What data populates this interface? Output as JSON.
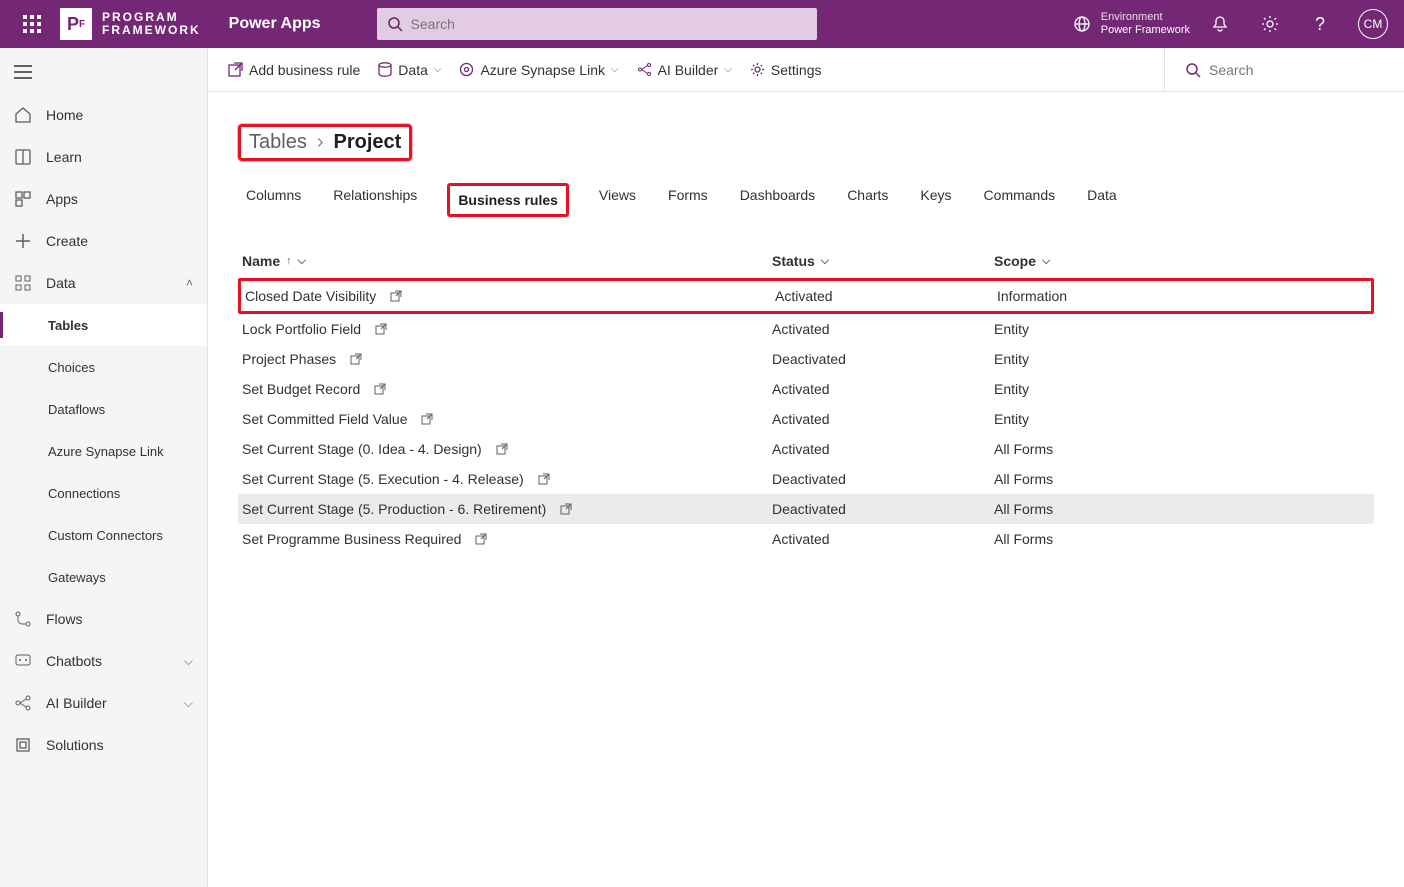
{
  "header": {
    "logo_line1": "PROGRAM",
    "logo_line2": "FRAMEWORK",
    "app_name": "Power Apps",
    "search_placeholder": "Search",
    "env_label": "Environment",
    "env_name": "Power Framework",
    "avatar_initials": "CM"
  },
  "sidebar": {
    "items": [
      {
        "icon": "home",
        "label": "Home"
      },
      {
        "icon": "book",
        "label": "Learn"
      },
      {
        "icon": "grid",
        "label": "Apps"
      },
      {
        "icon": "plus",
        "label": "Create"
      },
      {
        "icon": "data",
        "label": "Data",
        "expanded": true
      },
      {
        "sub": true,
        "label": "Tables",
        "selected": true
      },
      {
        "sub": true,
        "label": "Choices"
      },
      {
        "sub": true,
        "label": "Dataflows"
      },
      {
        "sub": true,
        "label": "Azure Synapse Link"
      },
      {
        "sub": true,
        "label": "Connections"
      },
      {
        "sub": true,
        "label": "Custom Connectors"
      },
      {
        "sub": true,
        "label": "Gateways"
      },
      {
        "icon": "flow",
        "label": "Flows"
      },
      {
        "icon": "chatbot",
        "label": "Chatbots",
        "chevron": true
      },
      {
        "icon": "ai",
        "label": "AI Builder",
        "chevron": true
      },
      {
        "icon": "solutions",
        "label": "Solutions"
      }
    ]
  },
  "toolbar": {
    "add_business_rule": "Add business rule",
    "data": "Data",
    "azure_synapse": "Azure Synapse Link",
    "ai_builder": "AI Builder",
    "settings": "Settings",
    "search_placeholder": "Search"
  },
  "breadcrumb": {
    "parent": "Tables",
    "current": "Project"
  },
  "tabs": [
    "Columns",
    "Relationships",
    "Business rules",
    "Views",
    "Forms",
    "Dashboards",
    "Charts",
    "Keys",
    "Commands",
    "Data"
  ],
  "active_tab": "Business rules",
  "columns": {
    "name": "Name",
    "status": "Status",
    "scope": "Scope"
  },
  "rows": [
    {
      "name": "Closed Date Visibility",
      "status": "Activated",
      "scope": "Information",
      "highlighted": true
    },
    {
      "name": "Lock Portfolio Field",
      "status": "Activated",
      "scope": "Entity"
    },
    {
      "name": "Project Phases",
      "status": "Deactivated",
      "scope": "Entity"
    },
    {
      "name": "Set Budget Record",
      "status": "Activated",
      "scope": "Entity"
    },
    {
      "name": "Set Committed Field Value",
      "status": "Activated",
      "scope": "Entity"
    },
    {
      "name": "Set Current Stage (0. Idea - 4. Design)",
      "status": "Activated",
      "scope": "All Forms"
    },
    {
      "name": "Set Current Stage (5. Execution - 4. Release)",
      "status": "Deactivated",
      "scope": "All Forms"
    },
    {
      "name": "Set Current Stage (5. Production - 6. Retirement)",
      "status": "Deactivated",
      "scope": "All Forms",
      "sel": true
    },
    {
      "name": "Set Programme Business Required",
      "status": "Activated",
      "scope": "All Forms"
    }
  ]
}
